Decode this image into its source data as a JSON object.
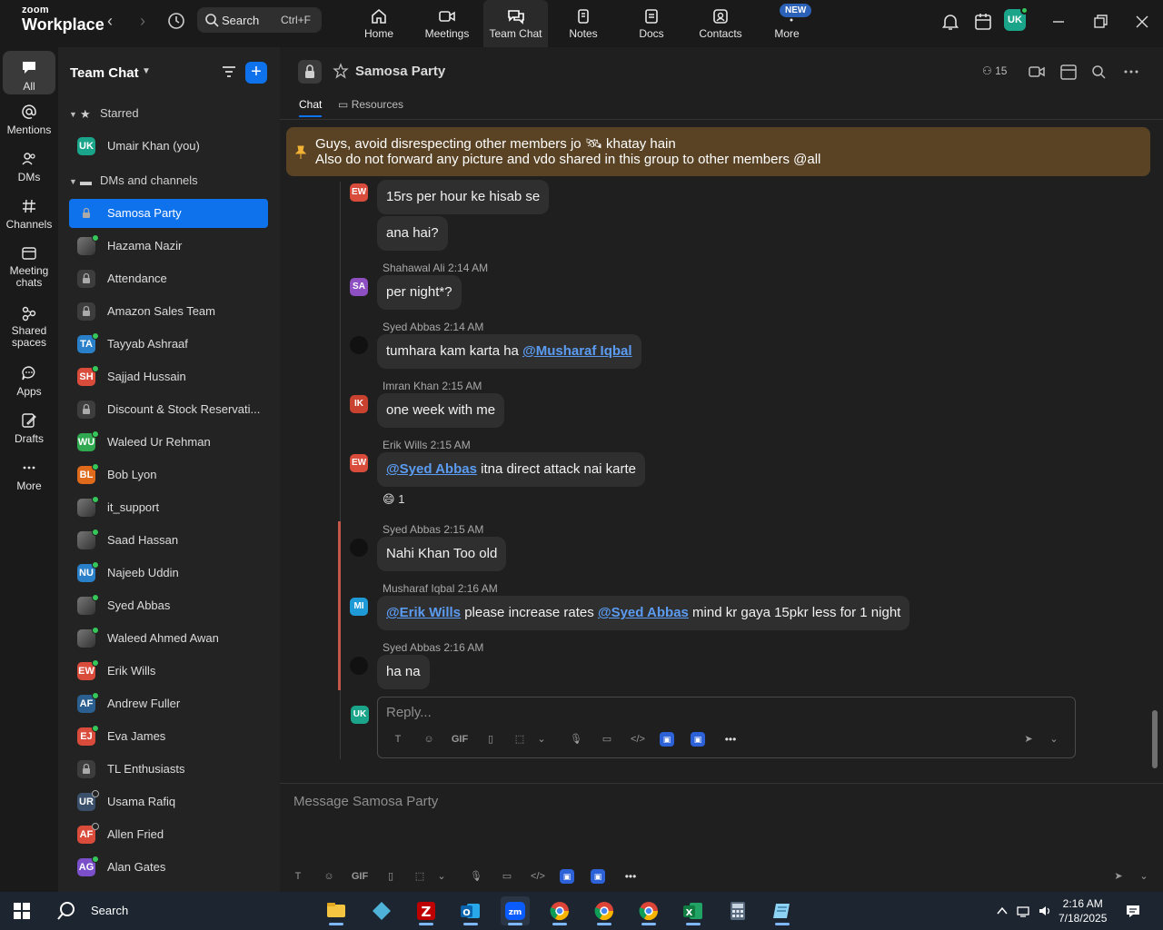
{
  "app": {
    "brand_small": "zoom",
    "brand_big": "Workplace"
  },
  "search": {
    "label": "Search",
    "shortcut": "Ctrl+F"
  },
  "top_tabs": [
    {
      "label": "Home"
    },
    {
      "label": "Meetings"
    },
    {
      "label": "Team Chat"
    },
    {
      "label": "Notes"
    },
    {
      "label": "Docs"
    },
    {
      "label": "Contacts"
    },
    {
      "label": "More"
    }
  ],
  "new_badge": "NEW",
  "user_initials": "UK",
  "rail": [
    {
      "label": "All"
    },
    {
      "label": "Mentions"
    },
    {
      "label": "DMs"
    },
    {
      "label": "Channels"
    },
    {
      "label": "Meeting chats"
    },
    {
      "label": "Shared spaces"
    },
    {
      "label": "Apps"
    },
    {
      "label": "Drafts"
    },
    {
      "label": "More"
    }
  ],
  "sidebar": {
    "title": "Team Chat",
    "starred_label": "Starred",
    "starred": [
      {
        "initials": "UK",
        "name": "Umair Khan (you)",
        "color": "#1aa58b"
      }
    ],
    "dms_label": "DMs and channels",
    "items": [
      {
        "initials": "",
        "name": "Samosa Party",
        "kind": "lock"
      },
      {
        "initials": "",
        "name": "Hazama Nazir",
        "kind": "img"
      },
      {
        "initials": "",
        "name": "Attendance",
        "kind": "lock"
      },
      {
        "initials": "",
        "name": "Amazon Sales Team",
        "kind": "lock"
      },
      {
        "initials": "TA",
        "name": "Tayyab Ashraaf",
        "color": "#2a7fc9"
      },
      {
        "initials": "SH",
        "name": "Sajjad Hussain",
        "color": "#d94b3b"
      },
      {
        "initials": "",
        "name": "Discount & Stock Reservati...",
        "kind": "lock"
      },
      {
        "initials": "WU",
        "name": "Waleed Ur Rehman",
        "color": "#2fa84f"
      },
      {
        "initials": "BL",
        "name": "Bob Lyon",
        "color": "#e06a1b"
      },
      {
        "initials": "",
        "name": "it_support",
        "kind": "img"
      },
      {
        "initials": "",
        "name": "Saad Hassan",
        "kind": "img"
      },
      {
        "initials": "NU",
        "name": "Najeeb Uddin",
        "color": "#2a7fc9"
      },
      {
        "initials": "",
        "name": "Syed Abbas",
        "kind": "img"
      },
      {
        "initials": "",
        "name": "Waleed Ahmed Awan",
        "kind": "img"
      },
      {
        "initials": "EW",
        "name": "Erik Wills",
        "color": "#d94b3b"
      },
      {
        "initials": "AF",
        "name": "Andrew Fuller",
        "color": "#2a5f8f"
      },
      {
        "initials": "EJ",
        "name": "Eva James",
        "color": "#d94b3b"
      },
      {
        "initials": "",
        "name": "TL Enthusiasts",
        "kind": "lock"
      },
      {
        "initials": "UR",
        "name": "Usama Rafiq",
        "color": "#3a4f6a"
      },
      {
        "initials": "AF",
        "name": "Allen Fried",
        "color": "#d94b3b"
      },
      {
        "initials": "AG",
        "name": "Alan Gates",
        "color": "#7a4fc9"
      }
    ]
  },
  "channel": {
    "title": "Samosa Party",
    "member_count": "15",
    "tab_chat": "Chat",
    "tab_resources": "Resources"
  },
  "pinned": {
    "line1": "Guys, avoid disrespecting other members jo 🛰 khatay hain",
    "line2": "Also do not forward any picture and vdo shared in this group to other members @all"
  },
  "messages": [
    {
      "sender": "",
      "avatar": "EW",
      "avatar_color": "#d94b3b",
      "parts": [
        {
          "t": "15rs per hour ke hisab se"
        }
      ]
    },
    {
      "sender": "",
      "avatar": "",
      "parts": [
        {
          "t": "ana hai?"
        }
      ]
    },
    {
      "sender": "Shahawal Ali 2:14 AM",
      "avatar": "SA",
      "avatar_color": "#8e4fc2",
      "parts": [
        {
          "t": "per night*?"
        }
      ]
    },
    {
      "sender": "Syed Abbas 2:14 AM",
      "avatar": "dark",
      "parts": [
        {
          "t": "tumhara kam karta ha "
        },
        {
          "m": "@Musharaf Iqbal"
        }
      ]
    },
    {
      "sender": "Imran Khan 2:15 AM",
      "avatar": "IK",
      "avatar_color": "#c9412f",
      "parts": [
        {
          "t": "one week with me"
        }
      ]
    },
    {
      "sender": "Erik Wills 2:15 AM",
      "avatar": "EW",
      "avatar_color": "#d94b3b",
      "parts": [
        {
          "m": "@Syed Abbas"
        },
        {
          "t": " itna direct attack nai karte"
        }
      ]
    },
    {
      "sender": "Syed Abbas 2:15 AM",
      "avatar": "dark",
      "parts": [
        {
          "t": "Nahi Khan Too old"
        }
      ]
    },
    {
      "sender": "Musharaf Iqbal 2:16 AM",
      "avatar": "MI",
      "avatar_color": "#1e9bd7",
      "parts": [
        {
          "m": "@Erik Wills"
        },
        {
          "t": " please increase rates "
        },
        {
          "m": "@Syed Abbas"
        },
        {
          "t": " mind kr gaya 15pkr less for 1 night"
        }
      ]
    },
    {
      "sender": "Syed Abbas 2:16 AM",
      "avatar": "dark",
      "parts": [
        {
          "t": "ha na"
        }
      ]
    }
  ],
  "reaction": {
    "emoji": "😄",
    "count": "1"
  },
  "reply": {
    "avatar": "UK",
    "placeholder": "Reply..."
  },
  "composer": {
    "placeholder": "Message Samosa Party"
  },
  "toolbar_gif": "GIF",
  "taskbar": {
    "search_label": "Search",
    "time": "2:16 AM",
    "date": "7/18/2025"
  }
}
